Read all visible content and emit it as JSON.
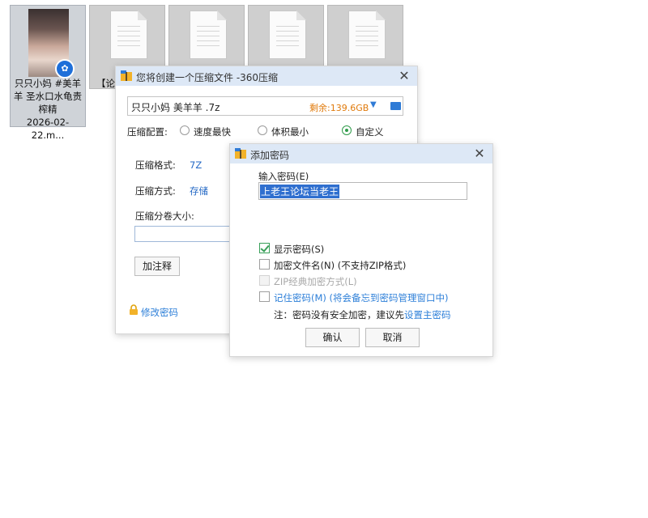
{
  "desktop": {
    "files": [
      {
        "name": "只只小妈 #美羊羊 圣水口水龟责榨精 2026-02-22.m...",
        "lines": [
          "只只小妈 #美羊",
          "羊 圣水口水龟责",
          "榨精",
          "2026-02-22.m..."
        ]
      },
      {
        "name": "【论坛"
      },
      {
        "name": ""
      },
      {
        "name": ""
      },
      {
        "name": ""
      }
    ]
  },
  "compress_dialog": {
    "title": "您将创建一个压缩文件 -360压缩",
    "path": "只只小妈 美羊羊  .7z",
    "free_space": "剩余:139.6GB",
    "config_label": "压缩配置:",
    "options": [
      {
        "label": "速度最快",
        "selected": false
      },
      {
        "label": "体积最小",
        "selected": false
      },
      {
        "label": "自定义",
        "selected": true
      }
    ],
    "format_label": "压缩格式:",
    "format_value": "7Z",
    "method_label": "压缩方式:",
    "method_value": "存储",
    "volume_label": "压缩分卷大小:",
    "volume_value": "",
    "comment_button": "加注释",
    "change_password": "修改密码"
  },
  "password_dialog": {
    "title": "添加密码",
    "enter_label": "输入密码(E)",
    "password_value": "上老王论坛当老王",
    "show_password": {
      "label": "显示密码(S)",
      "checked": true
    },
    "encrypt_names": {
      "label": "加密文件名(N) (不支持ZIP格式)",
      "checked": false
    },
    "zip_classic": {
      "label": "ZIP经典加密方式(L)",
      "checked": false,
      "disabled": true
    },
    "remember": {
      "label": "记住密码(M) (将会备忘到密码管理窗口中)",
      "checked": false
    },
    "note_prefix": "注：密码没有安全加密，建议先",
    "note_link": "设置主密码",
    "ok_button": "确认",
    "cancel_button": "取消"
  },
  "colors": {
    "accent_blue": "#2d7fd8",
    "free_space_orange": "#e07a0b",
    "check_green": "#3aa05a",
    "title_bar": "#dde8f6"
  },
  "icons": [
    "close-icon",
    "folder-icon",
    "dropdown-icon",
    "lock-icon",
    "archive-app-icon",
    "video-badge-icon"
  ]
}
